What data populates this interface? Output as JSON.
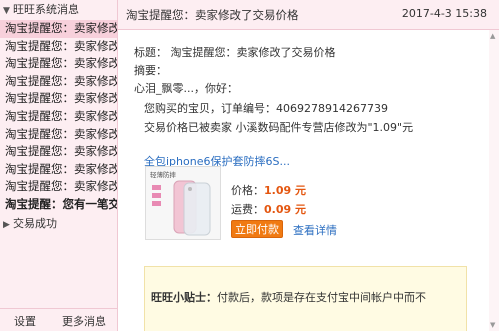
{
  "sidebar": {
    "group_title": "旺旺系统消息",
    "items": [
      {
        "label": "淘宝提醒您：卖家修改了交易价格",
        "selected": true
      },
      {
        "label": "淘宝提醒您：卖家修改了交易价格"
      },
      {
        "label": "淘宝提醒您：卖家修改了交易价格"
      },
      {
        "label": "淘宝提醒您：卖家修改了交易价格"
      },
      {
        "label": "淘宝提醒您：卖家修改了交易价格"
      },
      {
        "label": "淘宝提醒您：卖家修改了交易价格"
      },
      {
        "label": "淘宝提醒您：卖家修改了交易价格"
      },
      {
        "label": "淘宝提醒您：卖家修改了交易价格"
      },
      {
        "label": "淘宝提醒您：卖家修改了交易价格"
      },
      {
        "label": "淘宝提醒您：卖家修改了交易价格"
      },
      {
        "label": "淘宝提醒：您有一笔交易",
        "bold": true
      }
    ],
    "group2_title": "交易成功",
    "footer": {
      "settings": "设置",
      "more": "更多消息"
    }
  },
  "header": {
    "title": "淘宝提醒您：卖家修改了交易价格",
    "date": "2017-4-3 15:38"
  },
  "message": {
    "subject_line": "标题： 淘宝提醒您：卖家修改了交易价格",
    "summary_label": "摘要：",
    "greeting": "心泪_飘零...，你好：",
    "body_line1": "您购买的宝贝，订单编号：4069278914267739",
    "body_line2": "交易价格已被卖家 小溪数码配件专营店修改为\"1.09\"元",
    "product_title": "全包iphone6保护套防摔6S...",
    "price_label": "价格：",
    "price_value": "1.09 元",
    "shipping_label": "运费：",
    "shipping_value": "0.09 元",
    "pay_button": "立即付款",
    "detail_link": "查看详情",
    "thumb_caption": "轻薄防摔"
  },
  "tips": {
    "label": "旺旺小贴士：",
    "text": "付款后，款项是存在支付宝中间帐户中而不"
  },
  "colors": {
    "sidebar_bg": "#fdeef2",
    "selected_bg": "#f7d0db",
    "accent_orange": "#f07a12",
    "price_color": "#e4560f",
    "link_blue": "#2a6dc0",
    "tips_bg": "#fffbe3"
  }
}
